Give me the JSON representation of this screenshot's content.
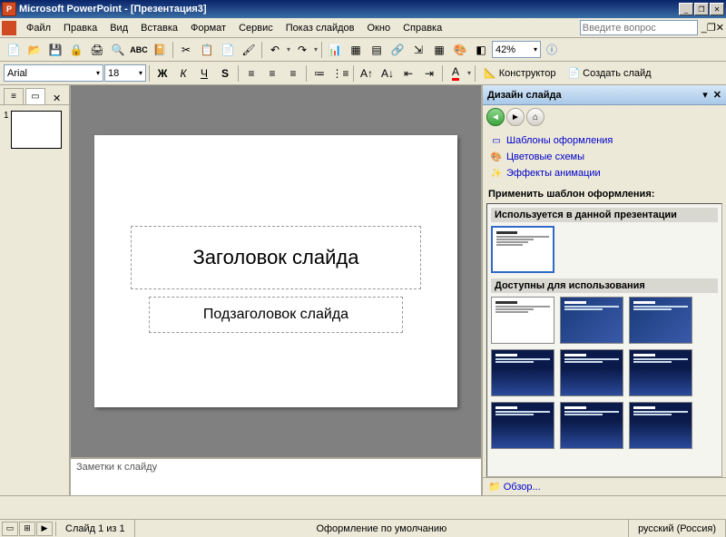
{
  "titlebar": {
    "title": "Microsoft PowerPoint - [Презентация3]"
  },
  "menu": {
    "file": "Файл",
    "edit": "Правка",
    "view": "Вид",
    "insert": "Вставка",
    "format": "Формат",
    "tools": "Сервис",
    "slideshow": "Показ слайдов",
    "window": "Окно",
    "help": "Справка",
    "help_placeholder": "Введите вопрос"
  },
  "format_toolbar": {
    "font": "Arial",
    "size": "18",
    "zoom": "42%",
    "designer": "Конструктор",
    "newslide": "Создать слайд"
  },
  "slide": {
    "title_placeholder": "Заголовок слайда",
    "subtitle_placeholder": "Подзаголовок слайда",
    "notes_placeholder": "Заметки к слайду",
    "thumb_number": "1"
  },
  "taskpane": {
    "title": "Дизайн слайда",
    "link_templates": "Шаблоны оформления",
    "link_colors": "Цветовые схемы",
    "link_animation": "Эффекты анимации",
    "apply_label": "Применить шаблон оформления:",
    "used_label": "Используется в данной презентации",
    "available_label": "Доступны для использования",
    "browse": "Обзор..."
  },
  "status": {
    "slide_of": "Слайд 1 из 1",
    "design": "Оформление по умолчанию",
    "lang": "русский (Россия)"
  }
}
